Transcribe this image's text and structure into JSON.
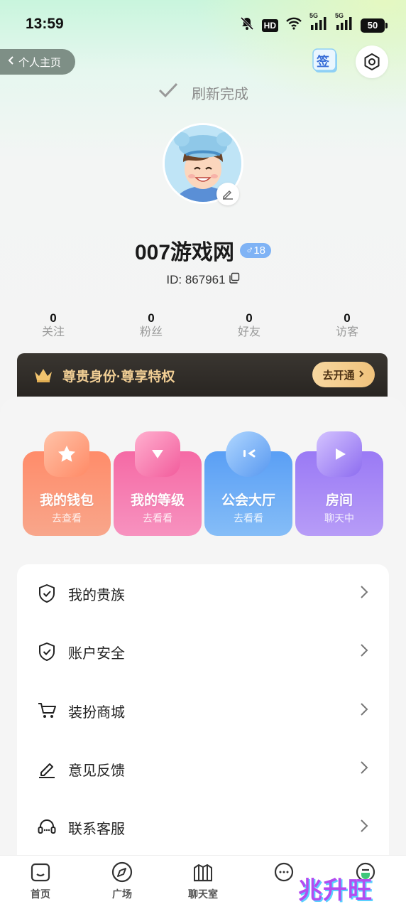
{
  "status_bar": {
    "time": "13:59",
    "hd_label": "HD",
    "net1": "5G",
    "net2": "5G",
    "battery": "50"
  },
  "header": {
    "back_label": "个人主页",
    "sign_label": "签",
    "refresh_status": "刷新完成"
  },
  "profile": {
    "name": "007游戏网",
    "gender_badge": "♂18",
    "id_text": "ID: 867961"
  },
  "stats": [
    {
      "value": "0",
      "label": "关注"
    },
    {
      "value": "0",
      "label": "粉丝"
    },
    {
      "value": "0",
      "label": "好友"
    },
    {
      "value": "0",
      "label": "访客"
    }
  ],
  "vip": {
    "text": "尊贵身份·尊享特权",
    "button": "去开通"
  },
  "features": [
    {
      "title": "我的钱包",
      "sub": "去查看",
      "color": "#fb8663"
    },
    {
      "title": "我的等级",
      "sub": "去看看",
      "color": "#f46ea6"
    },
    {
      "title": "公会大厅",
      "sub": "去看看",
      "color": "#5fa5f4"
    },
    {
      "title": "房间",
      "sub": "聊天中",
      "color": "#9b7cf3"
    }
  ],
  "menu": [
    {
      "label": "我的贵族",
      "icon": "shield-check-icon"
    },
    {
      "label": "账户安全",
      "icon": "shield-check-icon"
    },
    {
      "label": "装扮商城",
      "icon": "cart-icon"
    },
    {
      "label": "意见反馈",
      "icon": "pen-icon"
    },
    {
      "label": "联系客服",
      "icon": "headset-icon"
    }
  ],
  "nav": [
    {
      "label": "首页",
      "icon": "home-icon"
    },
    {
      "label": "广场",
      "icon": "compass-icon"
    },
    {
      "label": "聊天室",
      "icon": "chatroom-icon"
    },
    {
      "label": "",
      "icon": "message-icon"
    },
    {
      "label": "",
      "icon": "profile-icon"
    }
  ],
  "watermark": "兆升旺"
}
